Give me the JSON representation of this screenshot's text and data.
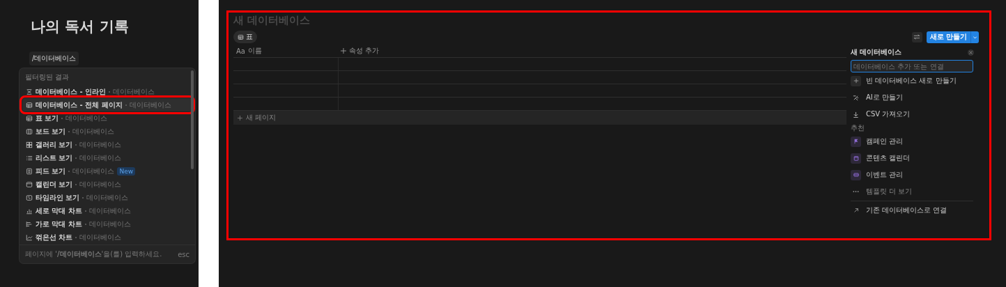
{
  "page_title": "나의 독서 기록",
  "slash_command": "/데이터베이스",
  "command_menu": {
    "section": "필터링된 결과",
    "items": [
      {
        "kind": "inline",
        "label": "데이터베이스 - 인라인",
        "type": "데이터베이스",
        "selected": false
      },
      {
        "kind": "table",
        "label": "데이터베이스 - 전체 페이지",
        "type": "데이터베이스",
        "selected": true
      },
      {
        "kind": "table",
        "label": "표 보기",
        "type": "데이터베이스",
        "selected": false
      },
      {
        "kind": "board",
        "label": "보드 보기",
        "type": "데이터베이스",
        "selected": false
      },
      {
        "kind": "gallery",
        "label": "갤러리 보기",
        "type": "데이터베이스",
        "selected": false
      },
      {
        "kind": "list",
        "label": "리스트 보기",
        "type": "데이터베이스",
        "selected": false
      },
      {
        "kind": "feed",
        "label": "피드 보기",
        "type": "데이터베이스",
        "badge": "New",
        "selected": false
      },
      {
        "kind": "calendar",
        "label": "캘린더 보기",
        "type": "데이터베이스",
        "selected": false
      },
      {
        "kind": "timeline",
        "label": "타임라인 보기",
        "type": "데이터베이스",
        "selected": false
      },
      {
        "kind": "vbar",
        "label": "세로 막대 차트",
        "type": "데이터베이스",
        "selected": false
      },
      {
        "kind": "hbar",
        "label": "가로 막대 차트",
        "type": "데이터베이스",
        "selected": false
      },
      {
        "kind": "line",
        "label": "꺾은선 차트",
        "type": "데이터베이스",
        "selected": false
      }
    ],
    "hint": "페이지에 '**/데이터베이스**'을(를) 입력하세요.",
    "esc": "esc"
  },
  "database": {
    "title": "새 데이터베이스",
    "views": [
      {
        "label": "표",
        "selected": true
      }
    ],
    "columns": [
      {
        "icon": "Aa",
        "label": "이름"
      },
      {
        "label": "속성 추가"
      }
    ],
    "new_page": "새 페이지",
    "create_button": "새로 만들기"
  },
  "side_panel": {
    "title": "새 데이터베이스",
    "search": {
      "placeholder": "데이터베이스 추가 또는 연결"
    },
    "actions": [
      {
        "kind": "plus",
        "label": "빈 데이터베이스 새로 만들기"
      },
      {
        "kind": "ai",
        "label": "AI로 만들기"
      },
      {
        "kind": "download",
        "label": "CSV 가져오기"
      }
    ],
    "suggested_heading": "추천",
    "templates": [
      {
        "kind": "flag",
        "label": "캠페인 관리"
      },
      {
        "kind": "calendar",
        "label": "콘텐츠 캘린더"
      },
      {
        "kind": "ticket",
        "label": "이벤트 관리"
      }
    ],
    "more": "템플릿 더 보기",
    "link": "기존 데이터베이스로 연결"
  }
}
